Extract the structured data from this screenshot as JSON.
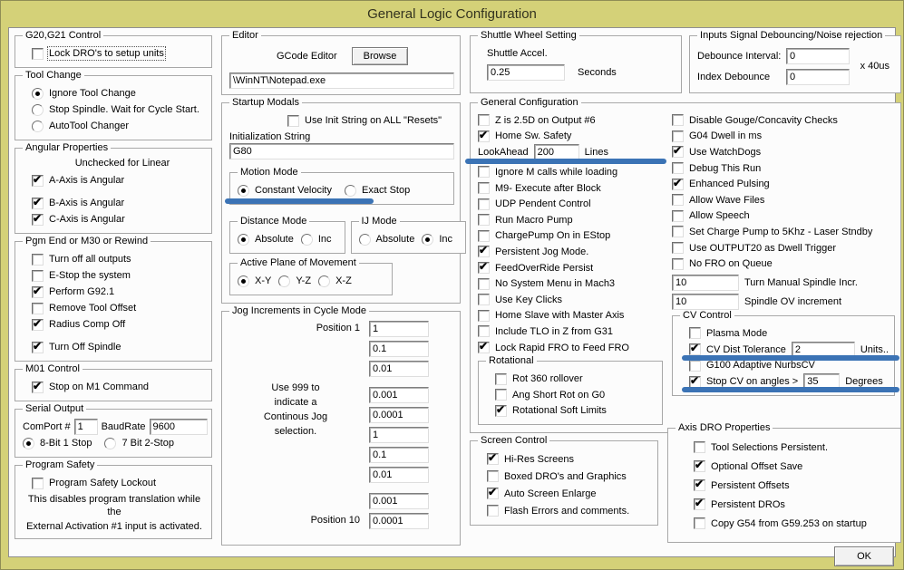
{
  "title": "General Logic Configuration",
  "chrome_color": "#d4d178",
  "annotation_color": "#3b73b5",
  "col1": {
    "g20": {
      "title": "G20,G21 Control",
      "items": [
        {
          "label": "Lock DRO's to setup units",
          "checked": false,
          "focus": true
        }
      ]
    },
    "tool_change": {
      "title": "Tool Change",
      "radios": [
        {
          "label": "Ignore Tool Change",
          "selected": true
        },
        {
          "label": "Stop Spindle. Wait for Cycle Start.",
          "selected": false
        },
        {
          "label": "AutoTool Changer",
          "selected": false
        }
      ]
    },
    "angular": {
      "title": "Angular Properties",
      "note": "Unchecked for Linear",
      "items": [
        {
          "label": "A-Axis is Angular",
          "checked": true
        },
        {
          "label": "B-Axis is Angular",
          "checked": true,
          "gap": true
        },
        {
          "label": "C-Axis is Angular",
          "checked": true
        }
      ]
    },
    "pgm_end": {
      "title": "Pgm End or M30 or Rewind",
      "items": [
        {
          "label": "Turn off all outputs",
          "checked": false
        },
        {
          "label": "E-Stop the system",
          "checked": false
        },
        {
          "label": "Perform G92.1",
          "checked": true
        },
        {
          "label": "Remove Tool Offset",
          "checked": false
        },
        {
          "label": "Radius Comp Off",
          "checked": true
        },
        {
          "label": "Turn Off Spindle",
          "checked": true,
          "gap": true
        }
      ]
    },
    "m01": {
      "title": "M01 Control",
      "items": [
        {
          "label": "Stop on M1 Command",
          "checked": true
        }
      ]
    },
    "serial": {
      "title": "Serial Output",
      "comport_label": "ComPort #",
      "comport_value": "1",
      "baud_label": "BaudRate",
      "baud_value": "9600",
      "radios": [
        {
          "label": "8-Bit 1 Stop",
          "selected": true
        },
        {
          "label": "7 Bit 2-Stop",
          "selected": false
        }
      ]
    },
    "program_safety": {
      "title": "Program Safety",
      "items": [
        {
          "label": "Program Safety Lockout",
          "checked": false
        }
      ],
      "note_lines": [
        "This disables program translation while the",
        "External Activation #1 input is activated."
      ]
    }
  },
  "col2": {
    "editor": {
      "title": "Editor",
      "gcode_label": "GCode Editor",
      "browse_label": "Browse",
      "path_value": "\\WinNT\\Notepad.exe"
    },
    "startup": {
      "title": "Startup Modals",
      "init_checkbox": {
        "label": "Use Init String on ALL  \"Resets\"",
        "checked": false
      },
      "init_string_label": "Initialization String",
      "init_string_value": "G80",
      "motion": {
        "title": "Motion Mode",
        "radios": [
          {
            "label": "Constant Velocity",
            "selected": true,
            "underline": true
          },
          {
            "label": "Exact Stop",
            "selected": false
          }
        ]
      },
      "distance": {
        "title": "Distance Mode",
        "radios": [
          {
            "label": "Absolute",
            "selected": true
          },
          {
            "label": "Inc",
            "selected": false
          }
        ]
      },
      "ij": {
        "title": "IJ Mode",
        "radios": [
          {
            "label": "Absolute",
            "selected": false
          },
          {
            "label": "Inc",
            "selected": true
          }
        ]
      },
      "plane": {
        "title": "Active Plane of Movement",
        "radios": [
          {
            "label": "X-Y",
            "selected": true
          },
          {
            "label": "Y-Z",
            "selected": false
          },
          {
            "label": "X-Z",
            "selected": false
          }
        ]
      }
    },
    "jog": {
      "title": "Jog Increments in Cycle Mode",
      "position1_label": "Position 1",
      "position10_label": "Position 10",
      "note_lines": [
        "Use 999 to",
        "indicate a",
        "Continous Jog",
        "selection."
      ],
      "values": [
        {
          "v": "1"
        },
        {
          "v": "0.1"
        },
        {
          "v": "0.01"
        },
        {
          "v": "0.001"
        },
        {
          "v": "0.0001"
        },
        {
          "v": "1"
        },
        {
          "v": "0.1"
        },
        {
          "v": "0.01"
        },
        {
          "v": "0.001"
        },
        {
          "v": "0.0001"
        }
      ]
    }
  },
  "col3": {
    "shuttle": {
      "title": "Shuttle Wheel Setting",
      "accel_label": "Shuttle Accel.",
      "accel_value": "0.25",
      "unit": "Seconds"
    },
    "debounce": {
      "title": "Inputs Signal Debouncing/Noise rejection",
      "interval_label": "Debounce Interval:",
      "interval_value": "0",
      "unit": "x 40us",
      "index_label": "Index Debounce",
      "index_value": "0"
    },
    "general": {
      "title": "General Configuration",
      "left_top": [
        {
          "label": "Z is 2.5D on Output #6",
          "checked": false
        },
        {
          "label": "Home Sw. Safety",
          "checked": true
        }
      ],
      "lookahead": {
        "label": "LookAhead",
        "value": "200",
        "unit": "Lines"
      },
      "left_rest": [
        {
          "label": "Ignore M calls while loading",
          "checked": false
        },
        {
          "label": "M9- Execute after Block",
          "checked": false
        },
        {
          "label": "UDP Pendent Control",
          "checked": false
        },
        {
          "label": "Run Macro Pump",
          "checked": false
        },
        {
          "label": "ChargePump On in EStop",
          "checked": false
        },
        {
          "label": "Persistent Jog Mode.",
          "checked": true
        },
        {
          "label": "FeedOverRide Persist",
          "checked": true
        },
        {
          "label": "No System Menu in Mach3",
          "checked": false
        },
        {
          "label": "Use Key Clicks",
          "checked": false
        },
        {
          "label": "Home Slave with Master Axis",
          "checked": false
        },
        {
          "label": "Include TLO in Z from G31",
          "checked": false
        },
        {
          "label": "Lock Rapid FRO to Feed FRO",
          "checked": true
        }
      ],
      "rotational": {
        "title": "Rotational",
        "items": [
          {
            "label": "Rot 360 rollover",
            "checked": false
          },
          {
            "label": "Ang Short Rot on G0",
            "checked": false
          },
          {
            "label": "Rotational Soft Limits",
            "checked": true
          }
        ]
      },
      "right": [
        {
          "label": "Disable Gouge/Concavity Checks",
          "checked": false
        },
        {
          "label": "G04 Dwell in ms",
          "checked": false
        },
        {
          "label": "Use WatchDogs",
          "checked": true
        },
        {
          "label": "Debug This Run",
          "checked": false
        },
        {
          "label": "Enhanced Pulsing",
          "checked": true
        },
        {
          "label": "Allow Wave Files",
          "checked": false
        },
        {
          "label": "Allow Speech",
          "checked": false
        },
        {
          "label": "Set Charge Pump to 5Khz  - Laser Stndby",
          "checked": false
        },
        {
          "label": "Use OUTPUT20 as Dwell Trigger",
          "checked": false
        },
        {
          "label": "No FRO on Queue",
          "checked": false
        }
      ],
      "spindle_rows": [
        {
          "value": "10",
          "label": "Turn Manual Spindle Incr."
        },
        {
          "value": "10",
          "label": "Spindle OV increment"
        }
      ],
      "cv": {
        "title": "CV Control",
        "plasma": {
          "label": "Plasma Mode",
          "checked": false
        },
        "dist": {
          "label": "CV Dist Tolerance",
          "checked": true,
          "value": "2",
          "unit": "Units.."
        },
        "nurbs": {
          "label": "G100 Adaptive NurbsCV",
          "checked": false
        },
        "stop": {
          "label": "Stop CV on angles >",
          "checked": true,
          "value": "35",
          "unit": "Degrees"
        }
      }
    },
    "screen": {
      "title": "Screen Control",
      "items": [
        {
          "label": "Hi-Res Screens",
          "checked": true
        },
        {
          "label": "Boxed DRO's and Graphics",
          "checked": false
        },
        {
          "label": "Auto Screen Enlarge",
          "checked": true
        },
        {
          "label": "Flash Errors and comments.",
          "checked": false
        }
      ]
    },
    "axis_dro": {
      "title": "Axis DRO Properties",
      "items": [
        {
          "label": "Tool Selections Persistent.",
          "checked": false
        },
        {
          "label": "Optional Offset Save",
          "checked": true
        },
        {
          "label": "Persistent Offsets",
          "checked": true
        },
        {
          "label": "Persistent DROs",
          "checked": true
        },
        {
          "label": "Copy G54 from G59.253 on startup",
          "checked": false
        }
      ]
    },
    "ok_label": "OK"
  }
}
